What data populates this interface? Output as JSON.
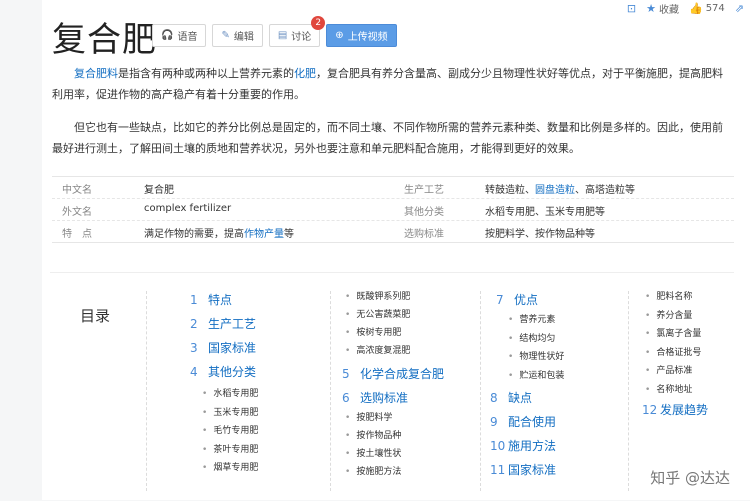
{
  "topbar": {
    "favorite_label": "收藏",
    "like_count": "574"
  },
  "title": "复合肥",
  "actions": {
    "voice": "语音",
    "edit": "编辑",
    "discuss": "讨论",
    "discuss_badge": "2",
    "upload": "上传视频"
  },
  "para1": {
    "link1": "复合肥料",
    "text1": "是指含有两种或两种以上营养元素的",
    "link2": "化肥",
    "text2": "，复合肥具有养分含量高、副成分少且物理性状好等优点，对于平衡施肥，提高肥料利用率，促进作物的高产稳产有着十分重要的作用。"
  },
  "para2": "但它也有一些缺点，比如它的养分比例总是固定的，而不同土壤、不同作物所需的营养元素种类、数量和比例是多样的。因此，使用前最好进行测土，了解田间土壤的质地和营养状况，另外也要注意和单元肥料配合施用，才能得到更好的效果。",
  "info": {
    "row1": {
      "k1": "中文名",
      "v1": "复合肥",
      "k2": "生产工艺",
      "v2a": "转鼓造粒、",
      "v2b": "圆盘造粒",
      "v2c": "、高塔造粒等"
    },
    "row2": {
      "k1": "外文名",
      "v1": "complex fertilizer",
      "k2": "其他分类",
      "v2": "水稻专用肥、玉米专用肥等"
    },
    "row3": {
      "k1": "特　点",
      "v1a": "满足作物的需要，提高",
      "v1b": "作物产量",
      "v1c": "等",
      "k2": "选购标准",
      "v2": "按肥料学、按作物品种等"
    }
  },
  "toc": {
    "label": "目录",
    "col1": [
      {
        "n": "1",
        "t": "特点"
      },
      {
        "n": "2",
        "t": "生产工艺"
      },
      {
        "n": "3",
        "t": "国家标准"
      },
      {
        "n": "4",
        "t": "其他分类"
      }
    ],
    "col1_sub": [
      "水稻专用肥",
      "玉米专用肥",
      "毛竹专用肥",
      "茶叶专用肥",
      "烟草专用肥"
    ],
    "col2_sub_top": [
      "既酸钾系列肥",
      "无公害蔬菜肥",
      "桉树专用肥",
      "高浓度复混肥"
    ],
    "col2": [
      {
        "n": "5",
        "t": "化学合成复合肥"
      },
      {
        "n": "6",
        "t": "选购标准"
      }
    ],
    "col2_sub_bottom": [
      "按肥料学",
      "按作物品种",
      "按土壤性状",
      "按施肥方法"
    ],
    "col3": [
      {
        "n": "7",
        "t": "优点"
      },
      {
        "n": "8",
        "t": "缺点"
      },
      {
        "n": "9",
        "t": "配合使用"
      },
      {
        "n": "10",
        "t": "施用方法"
      },
      {
        "n": "11",
        "t": "国家标准"
      }
    ],
    "col3_sub": [
      "营养元素",
      "结构均匀",
      "物理性状好",
      "贮运和包装"
    ],
    "col4_sub": [
      "肥料名称",
      "养分含量",
      "氯离子含量",
      "合格证批号",
      "产品标准",
      "名称地址"
    ],
    "col4": [
      {
        "n": "12",
        "t": "发展趋势"
      }
    ]
  },
  "watermark": "知乎 @达达"
}
